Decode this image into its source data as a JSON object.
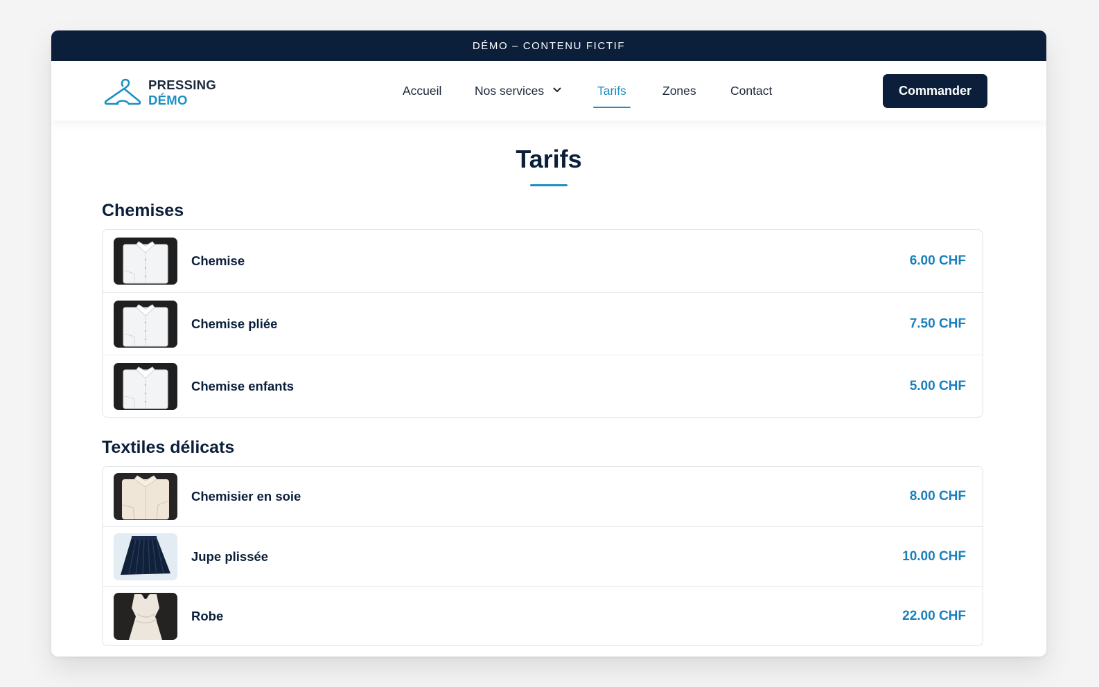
{
  "banner": {
    "text": "DÉMO – CONTENU FICTIF"
  },
  "logo": {
    "line1": "PRESSING",
    "line2": "DÉMO",
    "icon": "hanger-icon"
  },
  "nav": {
    "items": [
      {
        "label": "Accueil"
      },
      {
        "label": "Nos services",
        "icon": "chevron-down-icon"
      },
      {
        "label": "Tarifs",
        "active": true
      },
      {
        "label": "Zones"
      },
      {
        "label": "Contact"
      }
    ],
    "cta_label": "Commander"
  },
  "page": {
    "title": "Tarifs"
  },
  "sections": [
    {
      "title": "Chemises",
      "items": [
        {
          "name": "Chemise",
          "price": "6.00 CHF",
          "image": "white-shirt"
        },
        {
          "name": "Chemise pliée",
          "price": "7.50 CHF",
          "image": "white-shirt"
        },
        {
          "name": "Chemise enfants",
          "price": "5.00 CHF",
          "image": "white-shirt"
        }
      ]
    },
    {
      "title": "Textiles délicats",
      "items": [
        {
          "name": "Chemisier en soie",
          "price": "8.00 CHF",
          "image": "silk-blouse"
        },
        {
          "name": "Jupe plissée",
          "price": "10.00 CHF",
          "image": "pleated-skirt"
        },
        {
          "name": "Robe",
          "price": "22.00 CHF",
          "image": "dress"
        }
      ]
    }
  ],
  "colors": {
    "navy": "#0b1f3a",
    "accent": "#1a8fc4",
    "price": "#1a7fbd"
  }
}
